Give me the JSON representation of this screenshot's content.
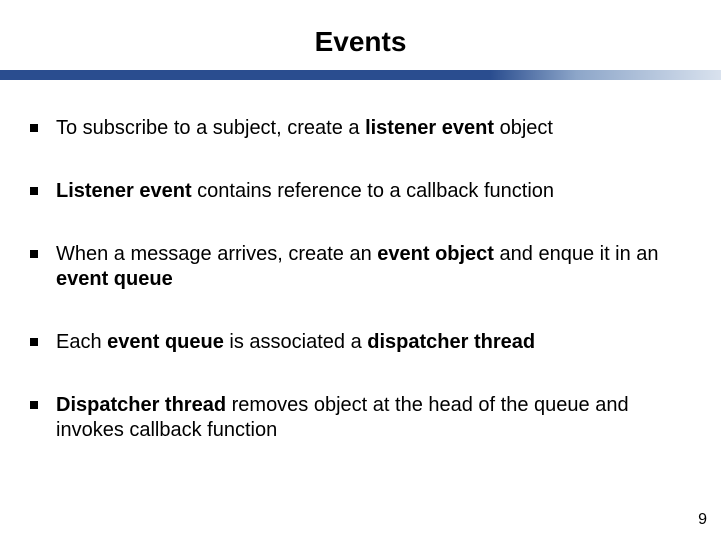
{
  "title": "Events",
  "bullets": [
    {
      "pre": "To subscribe to a subject, create a ",
      "b1": "listener event",
      "post": " object"
    },
    {
      "b1": "Listener event",
      "mid": " contains reference to a callback function"
    },
    {
      "pre": "When a message arrives, create an ",
      "b1": "event object",
      "mid": " and enque it in an ",
      "b2": "event queue"
    },
    {
      "pre": "Each ",
      "b1": "event queue",
      "mid": " is associated a ",
      "b2": "dispatcher thread"
    },
    {
      "b1": "Dispatcher thread",
      "mid": " removes object at the head of the queue and invokes callback function"
    }
  ],
  "page_number": "9"
}
